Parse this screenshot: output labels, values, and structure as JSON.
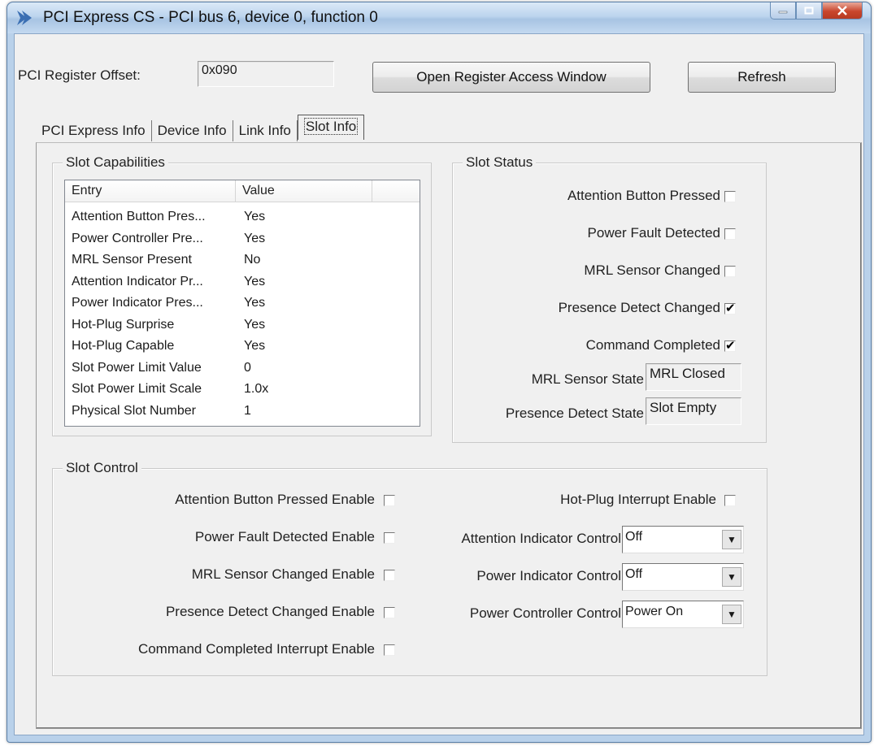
{
  "window": {
    "title": "PCI Express CS - PCI bus 6, device 0, function 0",
    "app_icon": "chevron-arrow-icon"
  },
  "toolbar": {
    "offset_label": "PCI Register Offset:",
    "offset_value": "0x090",
    "open_register_label": "Open Register Access Window",
    "refresh_label": "Refresh"
  },
  "tabs": [
    {
      "label": "PCI Express Info",
      "active": false
    },
    {
      "label": "Device Info",
      "active": false
    },
    {
      "label": "Link Info",
      "active": false
    },
    {
      "label": "Slot Info",
      "active": true
    }
  ],
  "slot_capabilities": {
    "title": "Slot Capabilities",
    "columns": [
      "Entry",
      "Value"
    ],
    "rows": [
      {
        "entry": "Attention Button Pres...",
        "value": "Yes"
      },
      {
        "entry": "Power Controller Pre...",
        "value": "Yes"
      },
      {
        "entry": "MRL Sensor Present",
        "value": "No"
      },
      {
        "entry": "Attention Indicator Pr...",
        "value": "Yes"
      },
      {
        "entry": "Power Indicator Pres...",
        "value": "Yes"
      },
      {
        "entry": "Hot-Plug Surprise",
        "value": "Yes"
      },
      {
        "entry": "Hot-Plug Capable",
        "value": "Yes"
      },
      {
        "entry": "Slot Power Limit Value",
        "value": "0"
      },
      {
        "entry": "Slot Power Limit Scale",
        "value": "1.0x"
      },
      {
        "entry": "Physical Slot Number",
        "value": "1"
      }
    ]
  },
  "slot_status": {
    "title": "Slot Status",
    "checks": [
      {
        "label": "Attention Button Pressed",
        "checked": false
      },
      {
        "label": "Power Fault Detected",
        "checked": false
      },
      {
        "label": "MRL Sensor Changed",
        "checked": false
      },
      {
        "label": "Presence Detect Changed",
        "checked": true
      },
      {
        "label": "Command Completed",
        "checked": true
      }
    ],
    "mrl_state_label": "MRL Sensor State",
    "mrl_state_value": "MRL Closed",
    "presence_state_label": "Presence Detect State",
    "presence_state_value": "Slot Empty"
  },
  "slot_control": {
    "title": "Slot Control",
    "left_checks": [
      {
        "label": "Attention Button Pressed Enable",
        "checked": false
      },
      {
        "label": "Power Fault Detected Enable",
        "checked": false
      },
      {
        "label": "MRL Sensor Changed Enable",
        "checked": false
      },
      {
        "label": "Presence Detect Changed Enable",
        "checked": false
      },
      {
        "label": "Command Completed Interrupt Enable",
        "checked": false
      }
    ],
    "hotplug_label": "Hot-Plug Interrupt Enable",
    "hotplug_checked": false,
    "combos": [
      {
        "label": "Attention Indicator Control",
        "value": "Off"
      },
      {
        "label": "Power Indicator Control",
        "value": "Off"
      },
      {
        "label": "Power Controller Control",
        "value": "Power On"
      }
    ]
  },
  "colors": {
    "window_frame": "#b9d1ea",
    "client_bg": "#f0f0f0",
    "close_button": "#c9462c"
  }
}
